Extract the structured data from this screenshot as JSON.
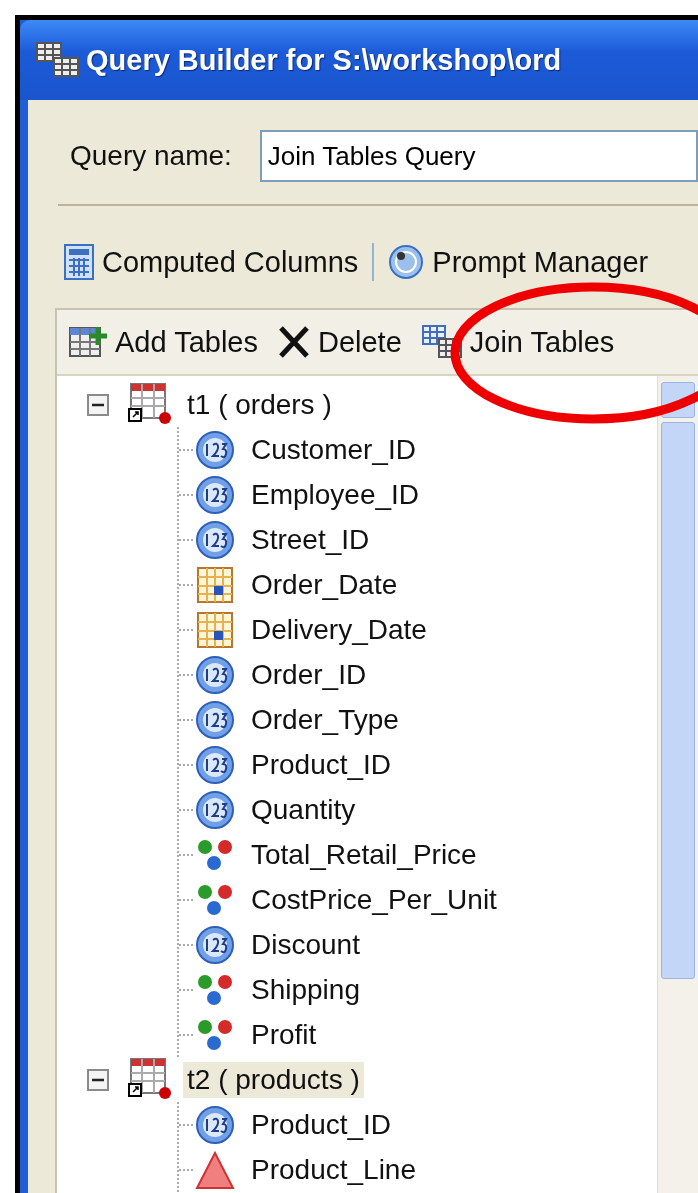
{
  "window": {
    "title": "Query Builder for S:\\workshop\\ord"
  },
  "query_name": {
    "label": "Query name:",
    "value": "Join Tables Query"
  },
  "toolbar": [
    {
      "label": "Computed Columns",
      "kind": "computed"
    },
    {
      "label": "Prompt Manager",
      "kind": "prompt"
    }
  ],
  "table_toolbar": [
    {
      "label": "Add Tables",
      "kind": "add"
    },
    {
      "label": "Delete",
      "kind": "delete"
    },
    {
      "label": "Join Tables",
      "kind": "join"
    }
  ],
  "tree": [
    {
      "label": "t1 ( orders )",
      "expanded": true,
      "selected": false,
      "children": [
        {
          "label": "Customer_ID",
          "kind": "numeric"
        },
        {
          "label": "Employee_ID",
          "kind": "numeric"
        },
        {
          "label": "Street_ID",
          "kind": "numeric"
        },
        {
          "label": "Order_Date",
          "kind": "date"
        },
        {
          "label": "Delivery_Date",
          "kind": "date"
        },
        {
          "label": "Order_ID",
          "kind": "numeric"
        },
        {
          "label": "Order_Type",
          "kind": "numeric"
        },
        {
          "label": "Product_ID",
          "kind": "numeric"
        },
        {
          "label": "Quantity",
          "kind": "numeric"
        },
        {
          "label": "Total_Retail_Price",
          "kind": "currency"
        },
        {
          "label": "CostPrice_Per_Unit",
          "kind": "currency"
        },
        {
          "label": "Discount",
          "kind": "numeric"
        },
        {
          "label": "Shipping",
          "kind": "currency"
        },
        {
          "label": "Profit",
          "kind": "currency"
        }
      ]
    },
    {
      "label": "t2 ( products )",
      "expanded": true,
      "selected": true,
      "children": [
        {
          "label": "Product_ID",
          "kind": "numeric"
        },
        {
          "label": "Product_Line",
          "kind": "character"
        }
      ]
    }
  ]
}
